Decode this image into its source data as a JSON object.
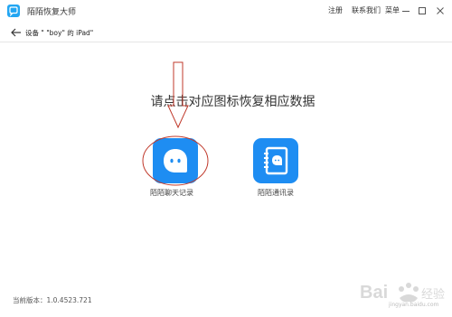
{
  "app": {
    "title": "陌陌恢复大师",
    "logo_icon": "momo-logo-icon"
  },
  "menu": {
    "register": "注册",
    "contact": "联系我们",
    "menu": "菜单"
  },
  "nav": {
    "back_icon": "back-arrow-icon",
    "device": "设备 \" \"boy\" 的 iPad\""
  },
  "main": {
    "prompt": "请点击对应图标恢复相应数据",
    "tiles": [
      {
        "label": "陌陌聊天记录",
        "icon": "chat-bubble-icon"
      },
      {
        "label": "陌陌通讯录",
        "icon": "contacts-book-icon"
      }
    ]
  },
  "footer": {
    "version": "当前版本：1.0.4523.721"
  },
  "watermark": {
    "logo_text": "Bai",
    "sub_text": "jingyan.baidu.com"
  },
  "colors": {
    "accent": "#1e8df2",
    "annotation": "#c0392b"
  }
}
